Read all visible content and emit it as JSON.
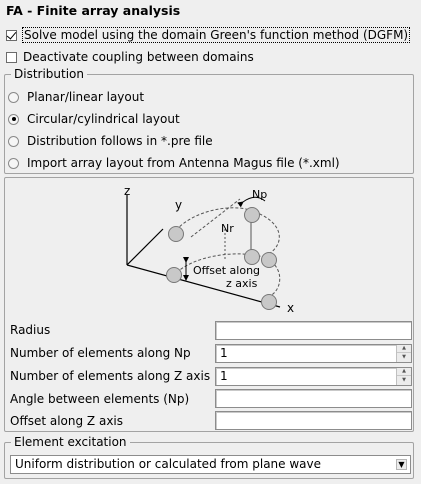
{
  "window": {
    "title": "FA - Finite array analysis"
  },
  "options": {
    "dgfm_label": "Solve model using the domain Green's function method (DGFM)",
    "dgfm_checked": true,
    "deactivate_label": "Deactivate coupling between domains",
    "deactivate_checked": false
  },
  "distribution": {
    "legend": "Distribution",
    "options": [
      {
        "label": "Planar/linear layout",
        "selected": false
      },
      {
        "label": "Circular/cylindrical layout",
        "selected": true
      },
      {
        "label": "Distribution follows in *.pre file",
        "selected": false
      },
      {
        "label": "Import array layout from Antenna Magus file (*.xml)",
        "selected": false
      }
    ]
  },
  "diagram": {
    "axis_z": "z",
    "axis_y": "y",
    "axis_x": "x",
    "label_np": "Np",
    "label_nr": "Nr",
    "label_offset_line1": "Offset along",
    "label_offset_line2": "z axis"
  },
  "form": {
    "radius": {
      "label": "Radius",
      "value": ""
    },
    "elements_np": {
      "label": "Number of elements along Np",
      "value": "1"
    },
    "elements_z": {
      "label": "Number of elements along Z axis",
      "value": "1"
    },
    "angle_np": {
      "label": "Angle between elements (Np)",
      "value": ""
    },
    "offset_z": {
      "label": "Offset along Z axis",
      "value": ""
    }
  },
  "excitation": {
    "legend": "Element excitation",
    "selected": "Uniform distribution or calculated from plane wave"
  },
  "colors": {
    "background": "#efefef",
    "element_fill": "#c8c8c8",
    "border": "#a3a3a3"
  }
}
